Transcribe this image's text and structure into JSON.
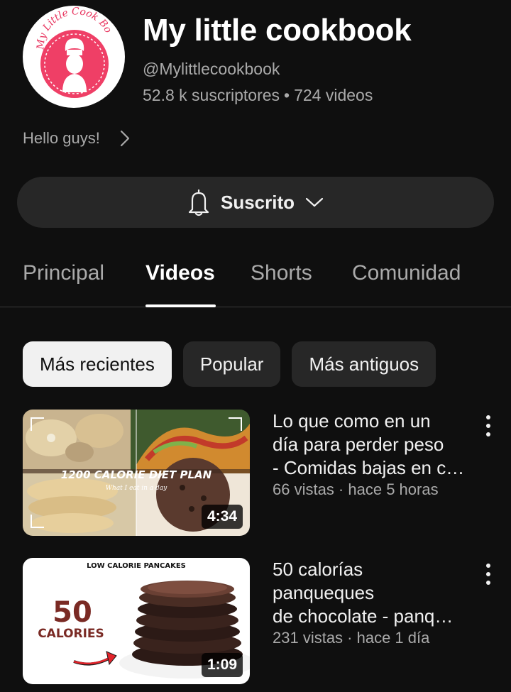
{
  "channel": {
    "logo_text": "My Little Cook Book",
    "name": "My little cookbook",
    "handle": "@Mylittlecookbook",
    "subscribers": "52.8 k suscriptores",
    "separator": "•",
    "video_count": "724 videos",
    "about": "Hello guys!",
    "about_icon": "chevron-right-icon",
    "brand_color": "#e8355f"
  },
  "subscribe": {
    "label": "Suscrito",
    "bell_icon": "bell-icon",
    "dropdown_icon": "chevron-down-icon"
  },
  "tabs": [
    {
      "label": "Principal",
      "active": false
    },
    {
      "label": "Videos",
      "active": true
    },
    {
      "label": "Shorts",
      "active": false
    },
    {
      "label": "Comunidad",
      "active": false
    }
  ],
  "chips": [
    {
      "label": "Más recientes",
      "selected": true
    },
    {
      "label": "Popular",
      "selected": false
    },
    {
      "label": "Más antiguos",
      "selected": false
    }
  ],
  "videos": [
    {
      "title_lines": [
        "Lo que como en un",
        "día para perder peso",
        "- Comidas bajas en c…"
      ],
      "meta": "66 vistas · hace 5 horas",
      "duration": "4:34",
      "thumb_title": "1200 CALORIE DIET PLAN",
      "thumb_subtitle": "What I eat in a day"
    },
    {
      "title_lines": [
        "50 calorías",
        "panqueques",
        "de chocolate - panq…"
      ],
      "meta": "231 vistas · hace 1 día",
      "duration": "1:09",
      "thumb_header": "LOW CALORIE PANCAKES",
      "thumb_big": "50",
      "thumb_small": "CALORIES"
    }
  ]
}
